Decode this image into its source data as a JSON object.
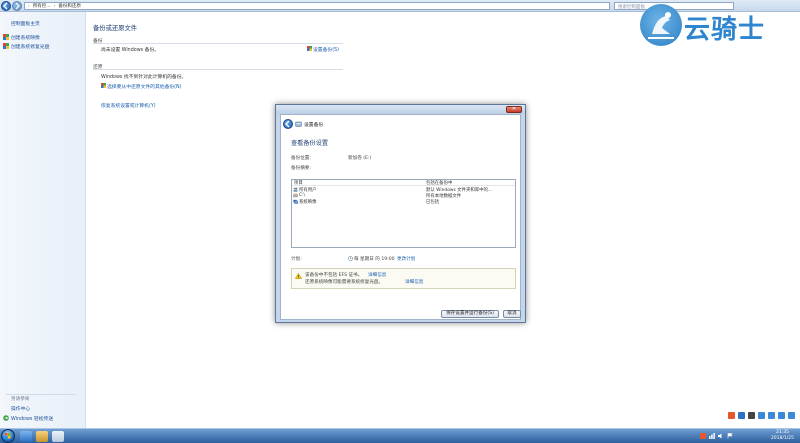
{
  "addressbar": {
    "crumbs": [
      "所有控...",
      "备份和还原"
    ],
    "search_placeholder": "搜索控制面板"
  },
  "leftpane": {
    "home": "控制面板主页",
    "items": [
      "创建系统映像",
      "创建系统修复光盘"
    ],
    "see_also_title": "另请参阅",
    "see_also": [
      "操作中心",
      "Windows 轻松传送"
    ]
  },
  "main": {
    "title": "备份或还原文件",
    "backup_section": "备份",
    "backup_status": "尚未设置 Windows 备份。",
    "setup_backup_link": "设置备份(S)",
    "restore_section": "还原",
    "restore_status": "Windows 找不到针对此计算机的备份。",
    "restore_other_link": "选择要从中还原文件的其他备份(N)",
    "recover_link": "恢复系统设置或计算机(Y)"
  },
  "dialog": {
    "window_title": "设置备份",
    "close_glyph": "✕",
    "heading": "查看备份设置",
    "location_label": "备份位置:",
    "location_value": "新加卷 (E:)",
    "summary_label": "备份摘要:",
    "columns": [
      "项目",
      "包括在备份中"
    ],
    "rows": [
      {
        "item": "所有用户",
        "included": "默认 Windows 文件夹和库中的..."
      },
      {
        "item": "C:\\",
        "included": "所有本地数据文件"
      },
      {
        "item": "系统映像",
        "included": "已包括"
      }
    ],
    "schedule_label": "计划:",
    "schedule_value": "每 星期日 的 19:00",
    "change_schedule": "更改计划",
    "warn_line1": "该备份中不包括 EFS 证书。",
    "warn_line1_link": "详细信息",
    "warn_line2": "还原系统映像可能需要系统修复光盘。",
    "warn_line2_link": "详细信息",
    "save_button": "保存设置并运行备份(S)",
    "cancel_button": "取消"
  },
  "watermark": {
    "text": "云骑士"
  },
  "taskbar": {
    "time": "21:35",
    "date": "2018/1/25"
  },
  "colors": {
    "link": "#1b5fae",
    "heading": "#1f3f72",
    "taskbar": "#2c5f9c",
    "watermark": "#2f86cf"
  }
}
